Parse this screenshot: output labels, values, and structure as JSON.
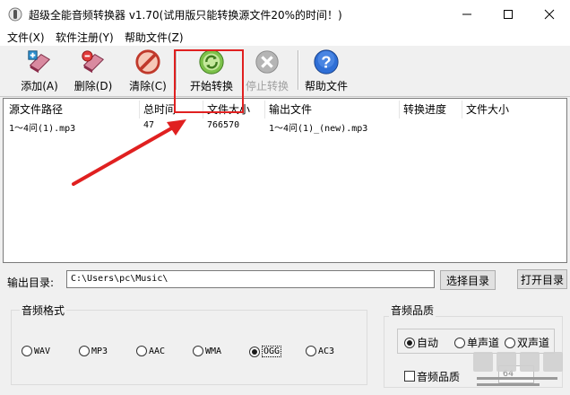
{
  "window": {
    "title": "超级全能音频转换器 v1.70(试用版只能转换源文件20%的时间！)"
  },
  "menu": [
    "文件(X)",
    "软件注册(Y)",
    "帮助文件(Z)"
  ],
  "toolbar": {
    "add": "添加(A)",
    "delete": "删除(D)",
    "clear": "清除(C)",
    "start": "开始转换",
    "stop": "停止转换",
    "help": "帮助文件"
  },
  "table": {
    "columns": [
      "源文件路径",
      "总时间",
      "文件大小",
      "输出文件",
      "转换进度",
      "文件大小"
    ],
    "rows": [
      {
        "source": "1～4问(1).mp3",
        "duration": "47",
        "size": "766570",
        "output": "1～4问(1)_(new).mp3",
        "progress": "",
        "out_size": ""
      }
    ]
  },
  "output": {
    "label": "输出目录:",
    "path": "C:\\Users\\pc\\Music\\",
    "choose": "选择目录",
    "open": "打开目录"
  },
  "format": {
    "title": "音频格式",
    "options": [
      "WAV",
      "MP3",
      "AAC",
      "WMA",
      "OGG",
      "AC3"
    ],
    "selected": "OGG"
  },
  "quality": {
    "title": "音频品质",
    "channels": [
      "自动",
      "单声道",
      "双声道"
    ],
    "selected": "自动",
    "check_label": "音频品质",
    "checked": false,
    "value": "64"
  },
  "colors": {
    "annotation": "#e02020",
    "list_bg": "#ffffff",
    "window_bg": "#f0f0f0"
  }
}
